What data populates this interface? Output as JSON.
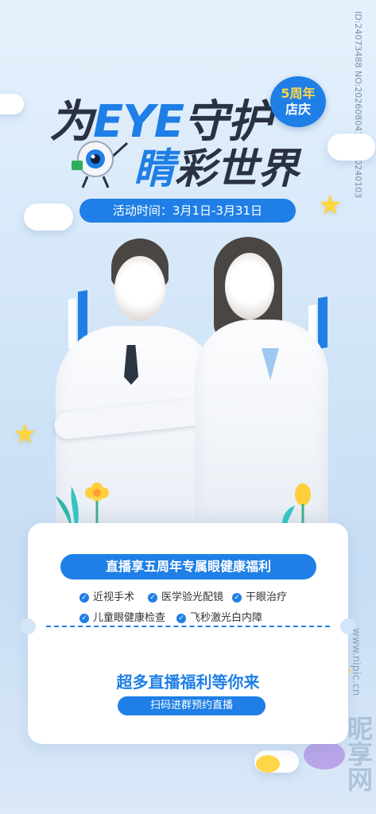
{
  "title": {
    "line1_prefix": "为",
    "line1_highlight": "EYE",
    "line1_suffix": "守护",
    "line2_highlight": "睛",
    "line2_rest": "彩世界"
  },
  "anniversary_badge": {
    "line1": "5周年",
    "line2": "店庆"
  },
  "activity_time": "活动时间：3月1日-3月31日",
  "watermark_id": "ID:24073488 NO:20260804137080240103",
  "card": {
    "headline": "直播享五周年专属眼健康福利",
    "services": [
      "近视手术",
      "医学验光配镜",
      "干眼治疗",
      "儿童眼健康检查",
      "飞秒激光白内障"
    ],
    "promo": "超多直播福利等你来",
    "scan_button": "扫码进群预约直播"
  },
  "site_mark": "www.nipic.cn",
  "site_logo_text": "昵享网",
  "colors": {
    "accent": "#1f7fe6",
    "dark": "#2a3242",
    "star": "#ffd53d"
  }
}
